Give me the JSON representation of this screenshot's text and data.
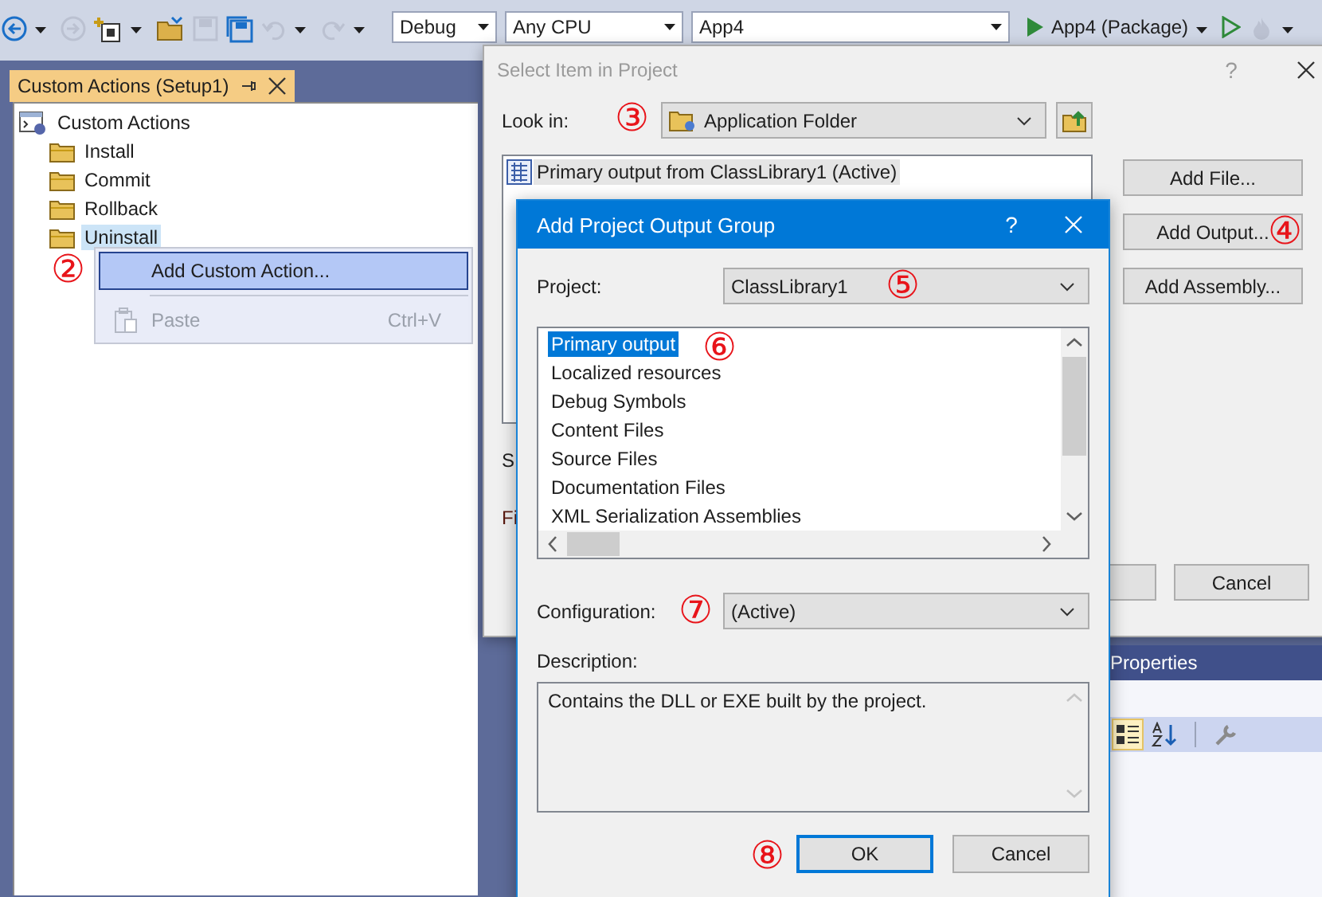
{
  "toolbar": {
    "buttons": [
      {
        "kind": "back",
        "disabled": false,
        "dropdown": true
      },
      {
        "kind": "forward",
        "disabled": true,
        "dropdown": false
      },
      {
        "kind": "new-project",
        "disabled": false,
        "dropdown": true
      },
      {
        "kind": "open",
        "disabled": false,
        "dropdown": false
      },
      {
        "kind": "save",
        "disabled": true,
        "dropdown": false
      },
      {
        "kind": "save-all",
        "disabled": false,
        "dropdown": false
      },
      {
        "kind": "undo",
        "disabled": true,
        "dropdown": true
      },
      {
        "kind": "redo",
        "disabled": true,
        "dropdown": true
      }
    ],
    "combos": [
      {
        "kind": "configuration",
        "value": "Debug"
      },
      {
        "kind": "platform",
        "value": "Any CPU"
      },
      {
        "kind": "startup",
        "value": "App4"
      }
    ],
    "run": {
      "label": "App4 (Package)"
    },
    "extra_buttons": [
      {
        "kind": "start-without-debugging",
        "disabled": false,
        "dropdown": false
      },
      {
        "kind": "hot-reload",
        "disabled": true,
        "dropdown": true
      }
    ]
  },
  "tool_window": {
    "tab": {
      "title": "Custom Actions (Setup1)",
      "selected": true
    },
    "tree": [
      {
        "kind": "root",
        "label": "Custom Actions",
        "selected": false,
        "children": [
          {
            "kind": "folder",
            "label": "Install",
            "selected": false
          },
          {
            "kind": "folder",
            "label": "Commit",
            "selected": false
          },
          {
            "kind": "folder",
            "label": "Rollback",
            "selected": false
          },
          {
            "kind": "folder",
            "label": "Uninstall",
            "selected": true
          }
        ]
      }
    ]
  },
  "context_menu": {
    "marker": "②",
    "items": [
      {
        "kind": "command",
        "label": "Add Custom Action...",
        "selected": true,
        "disabled": false
      },
      {
        "kind": "paste",
        "label": "Paste",
        "shortcut": "Ctrl+V",
        "selected": false,
        "disabled": true
      }
    ]
  },
  "select_item_dialog": {
    "title": "Select Item in Project",
    "help": "?",
    "active": false,
    "look_in": {
      "label": "Look in:",
      "value": "Application Folder",
      "marker": "③"
    },
    "items": [
      {
        "label": "Primary output from ClassLibrary1 (Active)",
        "selected": true
      }
    ],
    "side_buttons": [
      {
        "label": "Add File..."
      },
      {
        "label": "Add Output...",
        "marker": "④"
      },
      {
        "label": "Add Assembly..."
      }
    ],
    "covered_labels": [
      "S",
      "Fi"
    ],
    "bottom_buttons": [
      {
        "label": "Cancel"
      }
    ]
  },
  "properties_panel": {
    "title": "Properties",
    "view_buttons": [
      {
        "kind": "categorized",
        "selected": true
      },
      {
        "kind": "alphabetical",
        "selected": false
      },
      {
        "kind": "property-pages",
        "selected": false
      }
    ]
  },
  "output_group_dialog": {
    "title": "Add Project Output Group",
    "help": "?",
    "active": true,
    "project": {
      "label": "Project:",
      "value": "ClassLibrary1",
      "marker": "⑤"
    },
    "outputs": {
      "marker": "⑥",
      "items": [
        {
          "label": "Primary output",
          "selected": true
        },
        {
          "label": "Localized resources",
          "selected": false
        },
        {
          "label": "Debug Symbols",
          "selected": false
        },
        {
          "label": "Content Files",
          "selected": false
        },
        {
          "label": "Source Files",
          "selected": false
        },
        {
          "label": "Documentation Files",
          "selected": false
        },
        {
          "label": "XML Serialization Assemblies",
          "selected": false
        }
      ]
    },
    "configuration": {
      "label": "Configuration:",
      "value": "(Active)",
      "marker": "⑦"
    },
    "description": {
      "label": "Description:",
      "text": "Contains the DLL or EXE built by the project."
    },
    "buttons": [
      {
        "label": "OK",
        "default": true,
        "marker": "⑧"
      },
      {
        "label": "Cancel",
        "default": false
      }
    ]
  }
}
